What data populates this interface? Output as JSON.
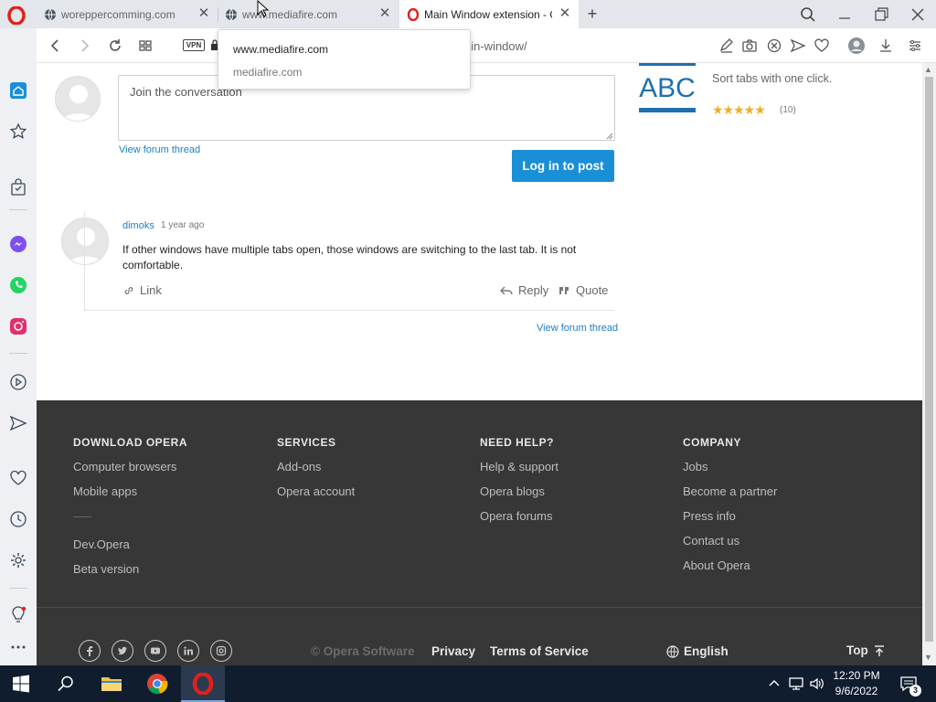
{
  "tabs": [
    {
      "title": "woreppercomming.com"
    },
    {
      "title": "www.mediafire.com"
    },
    {
      "title": "Main Window extension - O"
    }
  ],
  "addressbar": {
    "url_visible": "ain-window/",
    "vpn_label": "VPN"
  },
  "dropdown": {
    "suggestion_1": "www.mediafire.com",
    "suggestion_2": "mediafire.com"
  },
  "comment_form": {
    "placeholder": "Join the conversation",
    "view_thread": "View forum thread",
    "login_button": "Log in to post"
  },
  "comment": {
    "author": "dimoks",
    "time": "1 year ago",
    "text": "If other windows have multiple tabs open, those windows are switching to the last tab. It is not comfortable.",
    "link_label": "Link",
    "reply_label": "Reply",
    "quote_label": "Quote",
    "view_thread": "View forum thread"
  },
  "related": {
    "abc_text": "ABC",
    "description": "Sort tabs with one click.",
    "stars": "★★★★★",
    "rating_count": "(10)"
  },
  "footer": {
    "columns": [
      {
        "heading": "DOWNLOAD OPERA",
        "items": [
          "Computer browsers",
          "Mobile apps"
        ],
        "items2": [
          "Dev.Opera",
          "Beta version"
        ]
      },
      {
        "heading": "SERVICES",
        "items": [
          "Add-ons",
          "Opera account"
        ]
      },
      {
        "heading": "NEED HELP?",
        "items": [
          "Help & support",
          "Opera blogs",
          "Opera forums"
        ]
      },
      {
        "heading": "COMPANY",
        "items": [
          "Jobs",
          "Become a partner",
          "Press info",
          "Contact us",
          "About Opera"
        ]
      }
    ],
    "copyright": "© Opera Software",
    "privacy": "Privacy",
    "terms": "Terms of Service",
    "language": "English",
    "top": "Top"
  },
  "taskbar": {
    "time": "12:20 PM",
    "date": "9/6/2022",
    "notification_count": "3"
  },
  "colors": {
    "accent": "#1a8fd8",
    "footer_bg": "#373737",
    "opera_red": "#e0201b",
    "taskbar_bg": "#0f1d2e"
  }
}
